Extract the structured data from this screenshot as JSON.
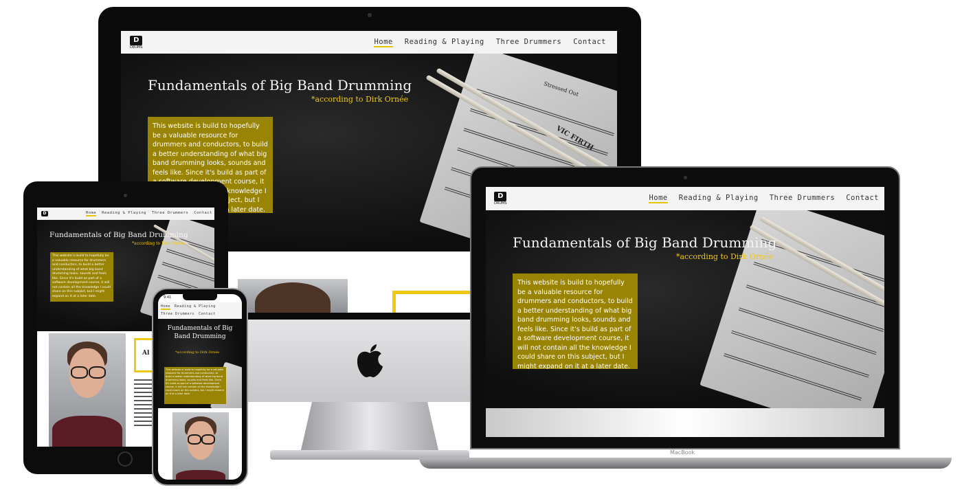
{
  "site": {
    "logo_text": "DRUMS",
    "nav": [
      "Home",
      "Reading & Playing",
      "Three Drummers",
      "Contact"
    ],
    "phone_nav_row1": [
      "Home",
      "Reading & Playing"
    ],
    "phone_nav_row2": [
      "Three Drummers",
      "Contact"
    ],
    "title": "Fundamentals of Big Band Drumming",
    "phone_title": "Fundamentals of Big Band Drumming",
    "subtitle": "*according to Dirk Ornée",
    "intro": "This website is build to hopefully be a valuable resource for drummers and conductors, to build a better understanding of what big band drumming looks, sounds and feels like. Since it's build as part of a software development course, it will not contain all the knowledge I could share on this subject, but I might expand on it at a later date.",
    "about_label": "Al",
    "stick_brand": "VIC FIRTH",
    "sheet_title": "Stressed Out"
  },
  "devices": {
    "laptop_brand": "MacBook",
    "phone_time": "9:41"
  },
  "colors": {
    "accent": "#f0c814",
    "intro_box": "#9a8403",
    "hero_bg": "#111111",
    "nav_bg": "#f4f4f4"
  },
  "icons": {
    "apple": "apple-logo-icon",
    "logo": "drums-logo-icon"
  }
}
